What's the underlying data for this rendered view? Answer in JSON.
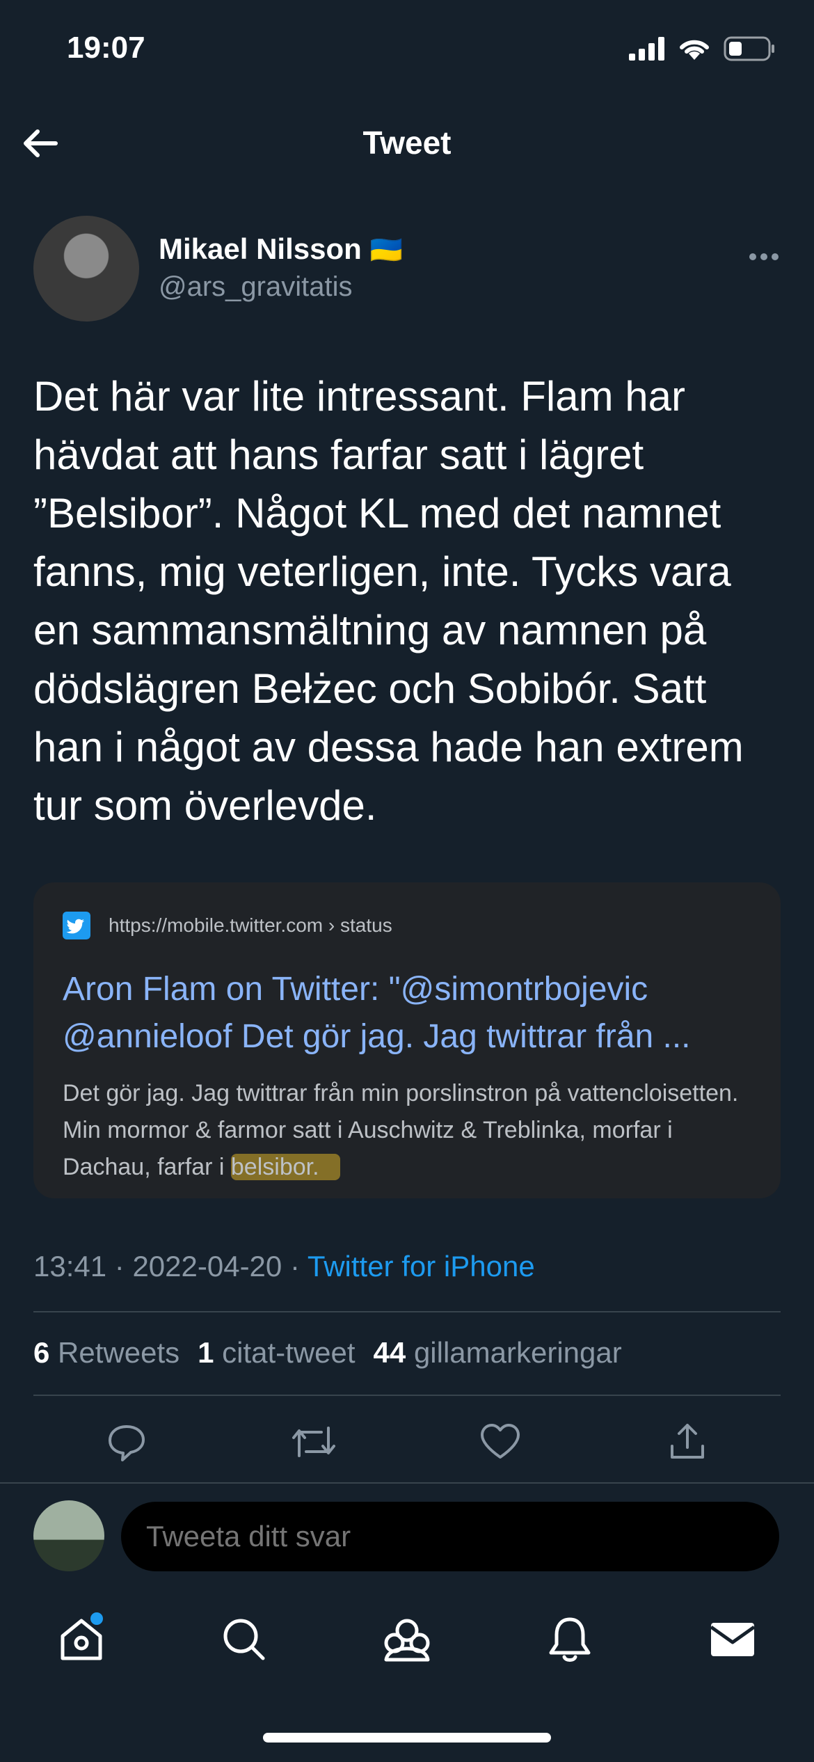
{
  "status_bar": {
    "time": "19:07"
  },
  "header": {
    "title": "Tweet"
  },
  "author": {
    "name": "Mikael Nilsson",
    "flag": "🇺🇦",
    "handle": "@ars_gravitatis"
  },
  "tweet": {
    "text": "Det här var lite intressant. Flam har hävdat att hans farfar satt i lägret ”Belsibor”. Något KL med det namnet fanns, mig veterligen, inte. Tycks vara en sammansmältning av namnen på dödslägren Bełżec och Sobibór. Satt han i något av dessa hade han extrem tur som överlevde."
  },
  "link_card": {
    "url": "https://mobile.twitter.com › status",
    "title": "Aron Flam on Twitter: \"@simontrbojevic @annieloof Det gör jag. Jag twittrar från ...",
    "description_pre": "Det gör jag. Jag twittrar från min porslinstron på vattencloisetten. Min mormor & farmor satt i Auschwitz & Treblinka, morfar i Dachau, farfar i ",
    "description_highlight": "belsibor."
  },
  "meta": {
    "time": "13:41",
    "date": "2022-04-20",
    "source": "Twitter for iPhone"
  },
  "stats": {
    "retweets_count": "6",
    "retweets_label": "Retweets",
    "quotes_count": "1",
    "quotes_label": "citat-tweet",
    "likes_count": "44",
    "likes_label": "gillamarkeringar"
  },
  "reply": {
    "placeholder": "Tweeta ditt svar"
  },
  "colors": {
    "background": "#15202B",
    "accent": "#1D9BF0",
    "secondary_text": "#8B98A5"
  },
  "icons": [
    "back-arrow-icon",
    "more-icon",
    "reply-icon",
    "retweet-icon",
    "like-icon",
    "share-icon",
    "home-icon",
    "search-icon",
    "communities-icon",
    "notifications-icon",
    "messages-icon"
  ]
}
